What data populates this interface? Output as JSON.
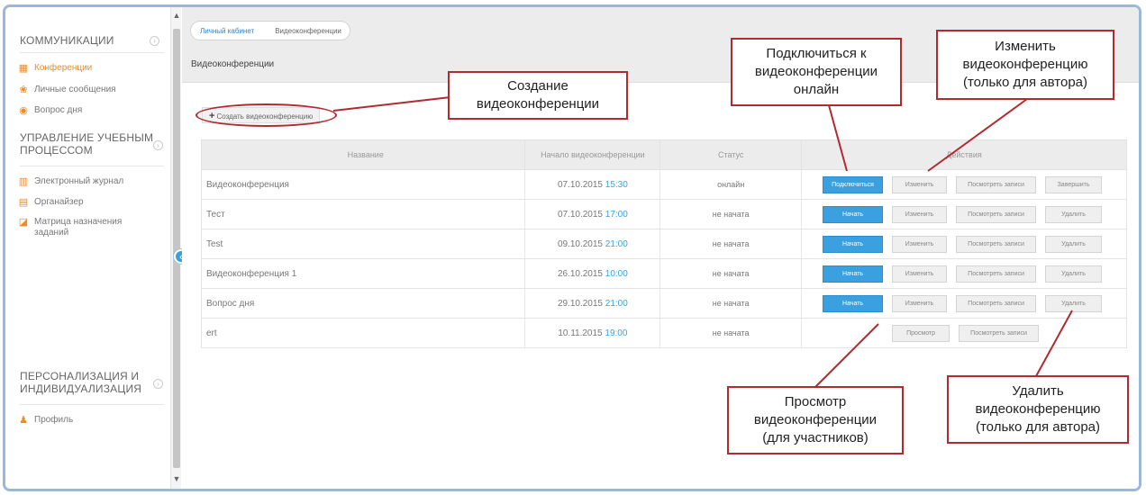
{
  "sidebar": {
    "sections": [
      {
        "title": "КОММУНИКАЦИИ",
        "items": [
          {
            "label": "Конференции",
            "icon": "conference-icon",
            "active": true
          },
          {
            "label": "Личные сообщения",
            "icon": "messages-icon"
          },
          {
            "label": "Вопрос дня",
            "icon": "question-icon"
          }
        ]
      },
      {
        "title_line1": "УПРАВЛЕНИЕ УЧЕБНЫМ",
        "title_line2": "ПРОЦЕССОМ",
        "items": [
          {
            "label": "Электронный журнал",
            "icon": "journal-icon"
          },
          {
            "label": "Органайзер",
            "icon": "organizer-icon"
          },
          {
            "label_line1": "Матрица назначения",
            "label_line2": "заданий",
            "icon": "matrix-icon"
          }
        ]
      },
      {
        "title_line1": "ПЕРСОНАЛИЗАЦИЯ И",
        "title_line2": "ИНДИВИДУАЛИЗАЦИЯ",
        "items": [
          {
            "label": "Профиль",
            "icon": "profile-icon"
          }
        ]
      }
    ]
  },
  "breadcrumb": {
    "home": "Личный кабинет",
    "current": "Видеоконференции"
  },
  "page_title": "Видеоконференции",
  "create_button": "Создать видеоконференцию",
  "table": {
    "headers": [
      "Название",
      "Начало видеоконференции",
      "Статус",
      "Действия"
    ],
    "rows": [
      {
        "name": "Видеоконференция",
        "date": "07.10.2015",
        "time": "15:30",
        "status": "онлайн",
        "actions": [
          "Подключиться",
          "Изменить",
          "Посмотреть записи",
          "Завершить"
        ]
      },
      {
        "name": "Тест",
        "date": "07.10.2015",
        "time": "17:00",
        "status": "не начата",
        "actions": [
          "Начать",
          "Изменить",
          "Посмотреть записи",
          "Удалить"
        ]
      },
      {
        "name": "Test",
        "date": "09.10.2015",
        "time": "21:00",
        "status": "не начата",
        "actions": [
          "Начать",
          "Изменить",
          "Посмотреть записи",
          "Удалить"
        ]
      },
      {
        "name": "Видеоконференция 1",
        "date": "26.10.2015",
        "time": "10:00",
        "status": "не начата",
        "actions": [
          "Начать",
          "Изменить",
          "Посмотреть записи",
          "Удалить"
        ]
      },
      {
        "name": "Вопрос дня",
        "date": "29.10.2015",
        "time": "21:00",
        "status": "не начата",
        "actions": [
          "Начать",
          "Изменить",
          "Посмотреть записи",
          "Удалить"
        ]
      },
      {
        "name": "ert",
        "date": "10.11.2015",
        "time": "19:00",
        "status": "не начата",
        "actions": [
          "Просмотр",
          "Посмотреть записи"
        ]
      }
    ]
  },
  "annotations": {
    "create": [
      "Создание",
      "видеоконференции"
    ],
    "connect": [
      "Подключиться к",
      "видеоконференции",
      "онлайн"
    ],
    "edit": [
      "Изменить",
      "видеоконференцию",
      "(только для автора)"
    ],
    "view": [
      "Просмотр",
      "видеоконференции",
      "(для участников)"
    ],
    "delete": [
      "Удалить",
      "видеоконференцию",
      "(только для автора)"
    ]
  },
  "colors": {
    "accent": "#f08a24",
    "primary_button": "#3aa0df",
    "annotation_border": "#b02a30",
    "time_text": "#39a3dc",
    "frame_border": "#9bb8d9"
  }
}
